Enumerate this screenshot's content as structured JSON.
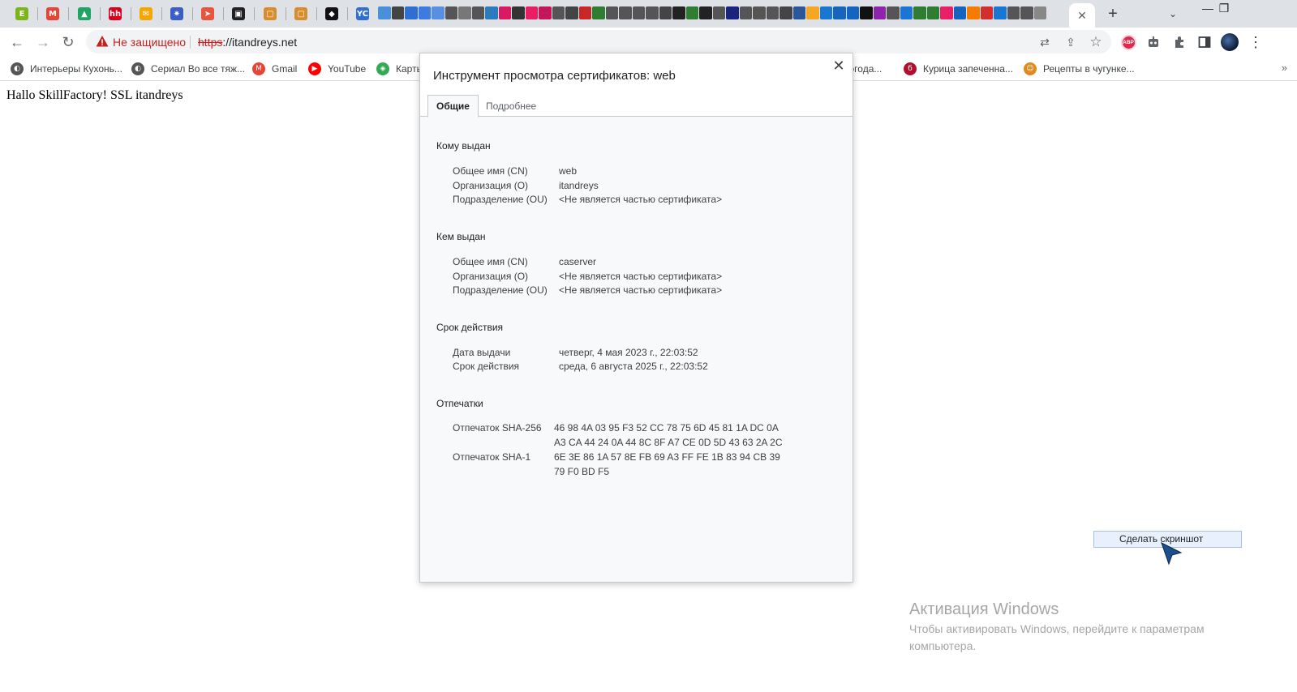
{
  "tabs": {
    "pinned": [
      {
        "name": "tab-fav-green-e",
        "glyph": "E",
        "color": "#7cb518"
      },
      {
        "name": "tab-fav-gmail",
        "glyph": "M",
        "color": "#ea4335"
      },
      {
        "name": "tab-fav-drive",
        "glyph": "▲",
        "color": "#1fa463"
      },
      {
        "name": "tab-fav-hh",
        "glyph": "hh",
        "color": "#d6001c"
      },
      {
        "name": "tab-fav-mail",
        "glyph": "✉",
        "color": "#f7a600"
      },
      {
        "name": "tab-fav-star",
        "glyph": "✷",
        "color": "#3b5ec6"
      },
      {
        "name": "tab-fav-arrow",
        "glyph": "➤",
        "color": "#e8553e"
      },
      {
        "name": "tab-fav-contact",
        "glyph": "▣",
        "color": "#202124"
      },
      {
        "name": "tab-fav-frame1",
        "glyph": "▢",
        "color": "#d98c2b"
      },
      {
        "name": "tab-fav-frame2",
        "glyph": "▢",
        "color": "#d98c2b"
      },
      {
        "name": "tab-fav-layers",
        "glyph": "◆",
        "color": "#111111"
      },
      {
        "name": "tab-fav-yc",
        "glyph": "YC",
        "color": "#2f6fd1"
      }
    ],
    "mini_colors": [
      "#4a90d9",
      "#444444",
      "#2f6fd1",
      "#3d7be0",
      "#5a8fe0",
      "#555555",
      "#777777",
      "#555555",
      "#2b7bbd",
      "#d81b60",
      "#333333",
      "#e91e63",
      "#c2185b",
      "#555555",
      "#444444",
      "#c62828",
      "#2e7d32",
      "#555555",
      "#555555",
      "#555555",
      "#555555",
      "#444444",
      "#222222",
      "#2e7d32",
      "#222222",
      "#555555",
      "#1a237e",
      "#555555",
      "#555555",
      "#555555",
      "#444444",
      "#2b579a",
      "#f5a623",
      "#1976d2",
      "#1565c0",
      "#1565c0",
      "#111111",
      "#8e24aa",
      "#555555",
      "#1976d2",
      "#2e7d32",
      "#2e7d32",
      "#e91e63",
      "#1565c0",
      "#f57c00",
      "#d32f2f",
      "#1976d2",
      "#555555",
      "#555555",
      "#888888"
    ],
    "active_close": "✕",
    "new_tab": "+",
    "tab_search": "⌄"
  },
  "window": {
    "minimize": "—",
    "restore": "❐"
  },
  "toolbar": {
    "back": "←",
    "forward": "→",
    "reload": "↻",
    "security_label": "Не защищено",
    "url_scheme": "https",
    "url_rest": "://itandreys.net",
    "translate_icon": "⇄",
    "share_icon": "⇪",
    "star_icon": "☆",
    "abp_label": "ABP",
    "puzzle_icon": "✚",
    "sidepanel_icon": "▮",
    "menu_icon": "⋮",
    "robot_icon": "●"
  },
  "bookmarks": [
    {
      "label": "Интерьеры Кухонь...",
      "icon_glyph": "◐",
      "icon_color": "#555555"
    },
    {
      "label": "Сериал Во все тяж...",
      "icon_glyph": "◐",
      "icon_color": "#555555"
    },
    {
      "label": "Gmail",
      "icon_glyph": "M",
      "icon_color": "#ea4335"
    },
    {
      "label": "YouTube",
      "icon_glyph": "▶",
      "icon_color": "#ff0000"
    },
    {
      "label": "Карты",
      "icon_glyph": "◈",
      "icon_color": "#34a853"
    },
    {
      "label": "погода...",
      "icon_glyph": "",
      "icon_color": "transparent"
    },
    {
      "label": "Курица запеченна...",
      "icon_glyph": "б",
      "icon_color": "#b0102e"
    },
    {
      "label": "Рецепты в чугунке...",
      "icon_glyph": "☺",
      "icon_color": "#e08a1e"
    }
  ],
  "bookmarks_more": "»",
  "page": {
    "text": "Hallo SkillFactory! SSL itandreys"
  },
  "dialog": {
    "title": "Инструмент просмотра сертификатов: web",
    "close": "✕",
    "tab_general": "Общие",
    "tab_details": "Подробнее",
    "issued_to": {
      "heading": "Кому выдан",
      "rows": [
        {
          "label": "Общее имя (CN)",
          "value": "web"
        },
        {
          "label": "Организация (O)",
          "value": "itandreys"
        },
        {
          "label": "Подразделение (OU)",
          "value": "<Не является частью сертификата>"
        }
      ]
    },
    "issued_by": {
      "heading": "Кем выдан",
      "rows": [
        {
          "label": "Общее имя (CN)",
          "value": "caserver"
        },
        {
          "label": "Организация (O)",
          "value": "<Не является частью сертификата>"
        },
        {
          "label": "Подразделение (OU)",
          "value": "<Не является частью сертификата>"
        }
      ]
    },
    "validity": {
      "heading": "Срок действия",
      "rows": [
        {
          "label": "Дата выдачи",
          "value": "четверг, 4 мая 2023 г., 22:03:52"
        },
        {
          "label": "Срок действия",
          "value": "среда, 6 августа 2025 г., 22:03:52"
        }
      ]
    },
    "fingerprints": {
      "heading": "Отпечатки",
      "sha256_label": "Отпечаток SHA-256",
      "sha256_line1": "46 98 4A 03 95 F3 52 CC 78 75 6D 45 81 1A DC 0A",
      "sha256_line2": "A3 CA 44 24 0A 44 8C 8F A7 CE 0D 5D 43 63 2A 2C",
      "sha1_label": "Отпечаток SHA-1",
      "sha1_line1": "6E 3E 86 1A 57 8E FB 69 A3 FF FE 1B 83 94 CB 39",
      "sha1_line2": "79 F0 BD F5"
    }
  },
  "popup": {
    "label": "Сделать скриншот"
  },
  "watermark": {
    "title": "Активация Windows",
    "subtitle": "Чтобы активировать Windows, перейдите к параметрам компьютера."
  }
}
